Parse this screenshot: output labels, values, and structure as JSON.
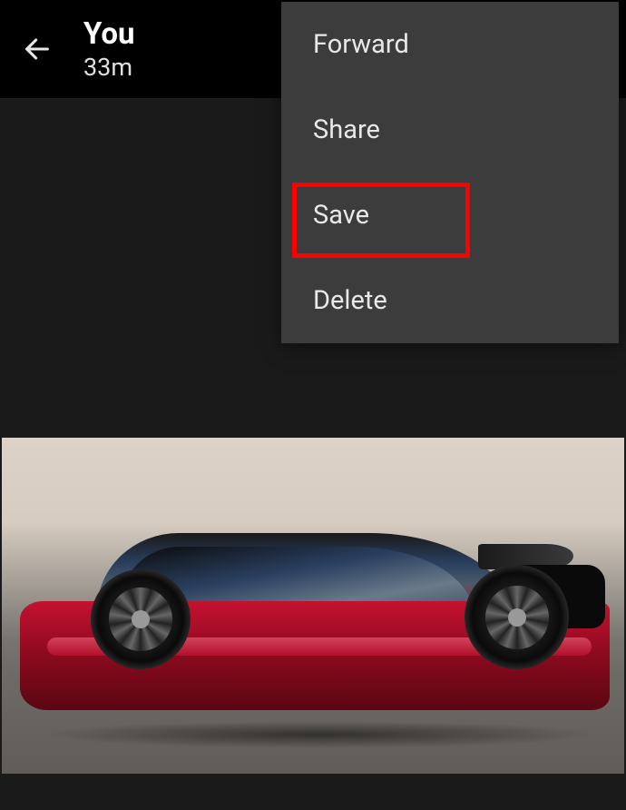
{
  "header": {
    "title": "You",
    "time": "33m"
  },
  "menu": {
    "items": [
      {
        "label": "Forward",
        "highlighted": false
      },
      {
        "label": "Share",
        "highlighted": false
      },
      {
        "label": "Save",
        "highlighted": true
      },
      {
        "label": "Delete",
        "highlighted": false
      }
    ]
  },
  "image": {
    "description": "red-sedan-car"
  }
}
